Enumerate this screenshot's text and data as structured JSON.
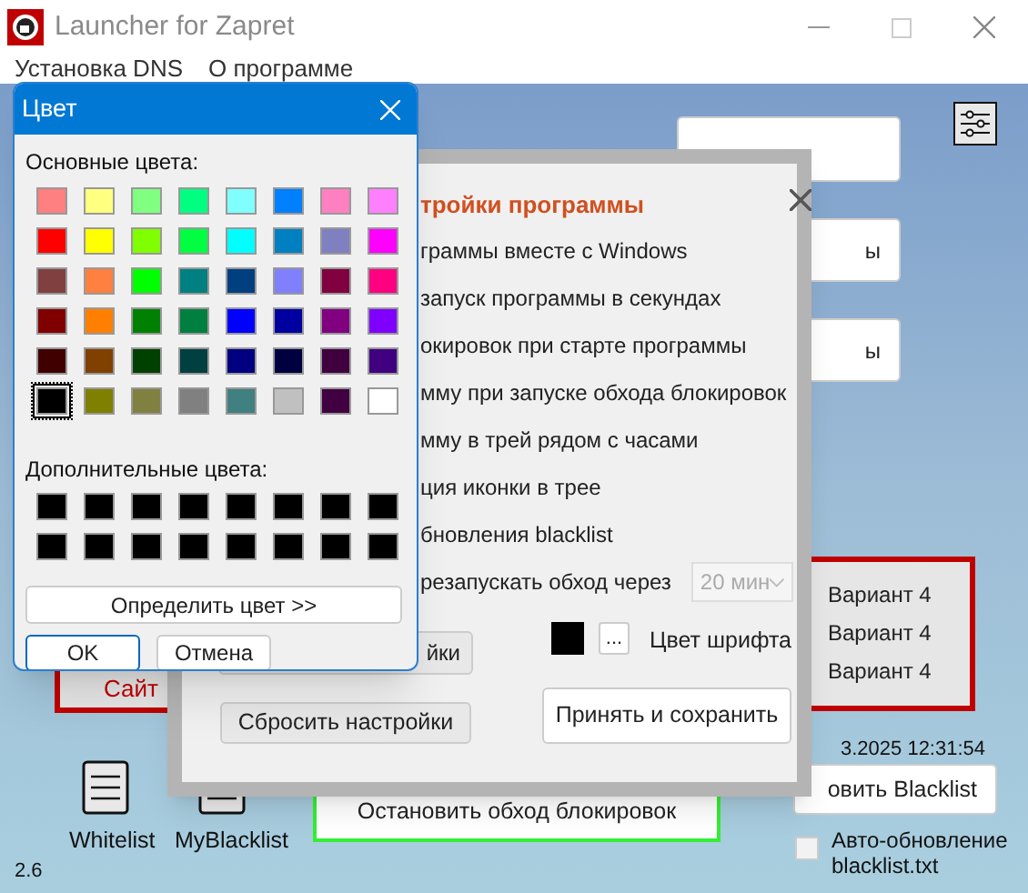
{
  "window": {
    "title": "Launcher for Zapret"
  },
  "menu": [
    {
      "label": "Установка DNS"
    },
    {
      "label": "О программе"
    }
  ],
  "side_buttons": [
    {
      "label": "ы"
    },
    {
      "label": "ы"
    }
  ],
  "left_box": {
    "text": "Сайт"
  },
  "variant_box": {
    "items": [
      "Вариант 4",
      "Вариант 4",
      "Вариант 4"
    ]
  },
  "timestamp": "3.2025 12:31:54",
  "update_button": "овить Blacklist",
  "auto_update": {
    "label": "Авто-обновление blacklist.txt",
    "checked": false
  },
  "stop_button": "Остановить обход блокировок",
  "lists": [
    {
      "label": "Whitelist"
    },
    {
      "label": "MyBlacklist"
    }
  ],
  "version": "2.6",
  "settings_dialog": {
    "title": "тройки программы",
    "options": [
      "граммы вместе с Windows",
      "запуск программы в секундах",
      "окировок при старте программы",
      "мму при запуске обхода блокировок",
      "мму в трей рядом с часами",
      "ция иконки в трее",
      "бновления blacklist",
      "резапускать обход через"
    ],
    "restart_interval": {
      "value": "20 мин"
    },
    "partial_button": "йки",
    "font_color": {
      "color": "#000000",
      "button": "...",
      "label": "Цвет шрифта"
    },
    "reset_button": "Сбросить настройки",
    "save_button": "Принять и сохранить"
  },
  "color_dialog": {
    "title": "Цвет",
    "basic_label": "Основные цвета:",
    "basic_colors": [
      {
        "color": "#ff8080",
        "selected": false
      },
      {
        "color": "#ffff80",
        "selected": false
      },
      {
        "color": "#80ff80",
        "selected": false
      },
      {
        "color": "#00ff80",
        "selected": false
      },
      {
        "color": "#80ffff",
        "selected": false
      },
      {
        "color": "#0080ff",
        "selected": false
      },
      {
        "color": "#ff80c0",
        "selected": false
      },
      {
        "color": "#ff80ff",
        "selected": false
      },
      {
        "color": "#ff0000",
        "selected": false
      },
      {
        "color": "#ffff00",
        "selected": false
      },
      {
        "color": "#80ff00",
        "selected": false
      },
      {
        "color": "#00ff40",
        "selected": false
      },
      {
        "color": "#00ffff",
        "selected": false
      },
      {
        "color": "#0080c0",
        "selected": false
      },
      {
        "color": "#8080c0",
        "selected": false
      },
      {
        "color": "#ff00ff",
        "selected": false
      },
      {
        "color": "#804040",
        "selected": false
      },
      {
        "color": "#ff8040",
        "selected": false
      },
      {
        "color": "#00ff00",
        "selected": false
      },
      {
        "color": "#008080",
        "selected": false
      },
      {
        "color": "#004080",
        "selected": false
      },
      {
        "color": "#8080ff",
        "selected": false
      },
      {
        "color": "#800040",
        "selected": false
      },
      {
        "color": "#ff0080",
        "selected": false
      },
      {
        "color": "#800000",
        "selected": false
      },
      {
        "color": "#ff8000",
        "selected": false
      },
      {
        "color": "#008000",
        "selected": false
      },
      {
        "color": "#008040",
        "selected": false
      },
      {
        "color": "#0000ff",
        "selected": false
      },
      {
        "color": "#0000a0",
        "selected": false
      },
      {
        "color": "#800080",
        "selected": false
      },
      {
        "color": "#8000ff",
        "selected": false
      },
      {
        "color": "#400000",
        "selected": false
      },
      {
        "color": "#804000",
        "selected": false
      },
      {
        "color": "#004000",
        "selected": false
      },
      {
        "color": "#004040",
        "selected": false
      },
      {
        "color": "#000080",
        "selected": false
      },
      {
        "color": "#000040",
        "selected": false
      },
      {
        "color": "#400040",
        "selected": false
      },
      {
        "color": "#400080",
        "selected": false
      },
      {
        "color": "#000000",
        "selected": true
      },
      {
        "color": "#808000",
        "selected": false
      },
      {
        "color": "#808040",
        "selected": false
      },
      {
        "color": "#808080",
        "selected": false
      },
      {
        "color": "#408080",
        "selected": false
      },
      {
        "color": "#c0c0c0",
        "selected": false
      },
      {
        "color": "#400041",
        "selected": false
      },
      {
        "color": "#ffffff",
        "selected": false
      }
    ],
    "custom_label": "Дополнительные цвета:",
    "custom_colors": [
      {
        "color": "#000000"
      },
      {
        "color": "#000000"
      },
      {
        "color": "#000000"
      },
      {
        "color": "#000000"
      },
      {
        "color": "#000000"
      },
      {
        "color": "#000000"
      },
      {
        "color": "#000000"
      },
      {
        "color": "#000000"
      },
      {
        "color": "#000000"
      },
      {
        "color": "#000000"
      },
      {
        "color": "#000000"
      },
      {
        "color": "#000000"
      },
      {
        "color": "#000000"
      },
      {
        "color": "#000000"
      },
      {
        "color": "#000000"
      },
      {
        "color": "#000000"
      }
    ],
    "define_button": "Определить цвет >>",
    "ok_button": "OK",
    "cancel_button": "Отмена"
  }
}
